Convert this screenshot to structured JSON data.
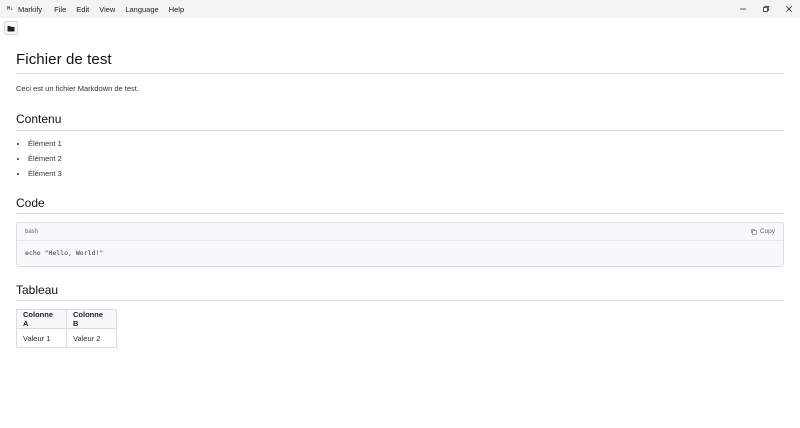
{
  "window": {
    "app_name": "Markify",
    "app_icon": "M↓",
    "menu": [
      "File",
      "Edit",
      "View",
      "Language",
      "Help"
    ],
    "controls": [
      "minimize-icon",
      "restore-icon",
      "close-icon"
    ]
  },
  "toolbar": {
    "open_folder_icon": "folder-icon"
  },
  "document": {
    "title": "Fichier de test",
    "intro": "Ceci est un fichier Markdown de test.",
    "section_contenu": {
      "heading": "Contenu",
      "items": [
        "Élément 1",
        "Élément 2",
        "Élément 3"
      ]
    },
    "section_code": {
      "heading": "Code",
      "language": "bash",
      "copy_label": "Copy",
      "code": "echo \"Hello, World!\""
    },
    "section_tableau": {
      "heading": "Tableau",
      "headers": [
        "Colonne A",
        "Colonne B"
      ],
      "rows": [
        [
          "Valeur 1",
          "Valeur 2"
        ]
      ]
    }
  }
}
